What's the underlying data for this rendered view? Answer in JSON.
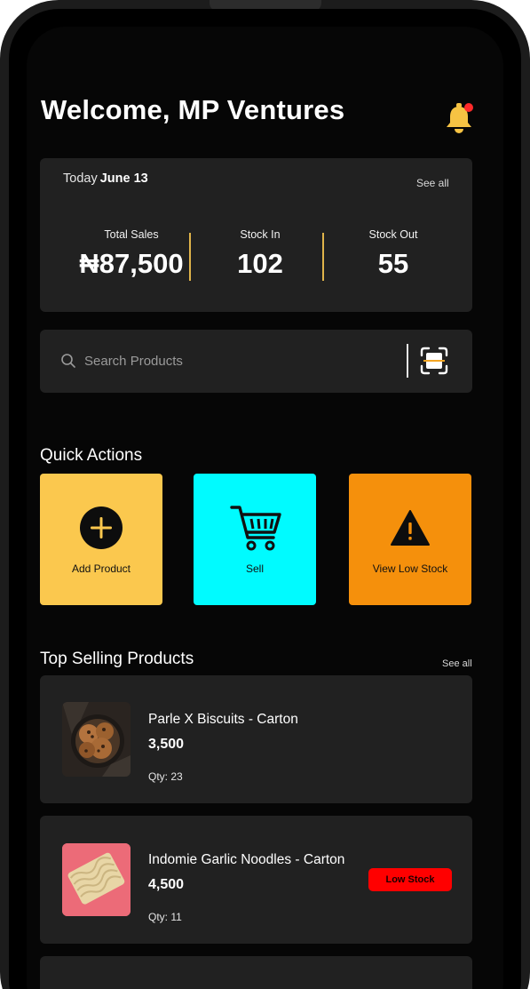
{
  "header": {
    "title": "Welcome, MP Ventures"
  },
  "summary": {
    "today_label": "Today",
    "date": "June 13",
    "see_all": "See all",
    "stats": [
      {
        "label": "Total Sales",
        "value": "₦87,500"
      },
      {
        "label": "Stock In",
        "value": "102"
      },
      {
        "label": "Stock Out",
        "value": "55"
      }
    ]
  },
  "search": {
    "placeholder": "Search Products"
  },
  "quick_actions": {
    "title": "Quick Actions",
    "items": [
      {
        "label": "Add Product",
        "color": "#fbc84e",
        "icon": "plus-circle-icon"
      },
      {
        "label": "Sell",
        "color": "#00fbff",
        "icon": "cart-icon"
      },
      {
        "label": "View Low Stock",
        "color": "#f5900c",
        "icon": "warning-icon"
      }
    ]
  },
  "top_selling": {
    "title": "Top Selling Products",
    "see_all": "See all",
    "products": [
      {
        "name": "Parle X Biscuits - Carton",
        "price": "3,500",
        "qty": "Qty: 23",
        "badge": ""
      },
      {
        "name": "Indomie Garlic Noodles - Carton",
        "price": "4,500",
        "qty": "Qty: 11",
        "badge": "Low Stock"
      }
    ]
  },
  "colors": {
    "accent": "#fbc84e",
    "notification_dot": "#ff2a2a",
    "low_stock": "#ff0000",
    "divider": "#e0b44a"
  }
}
